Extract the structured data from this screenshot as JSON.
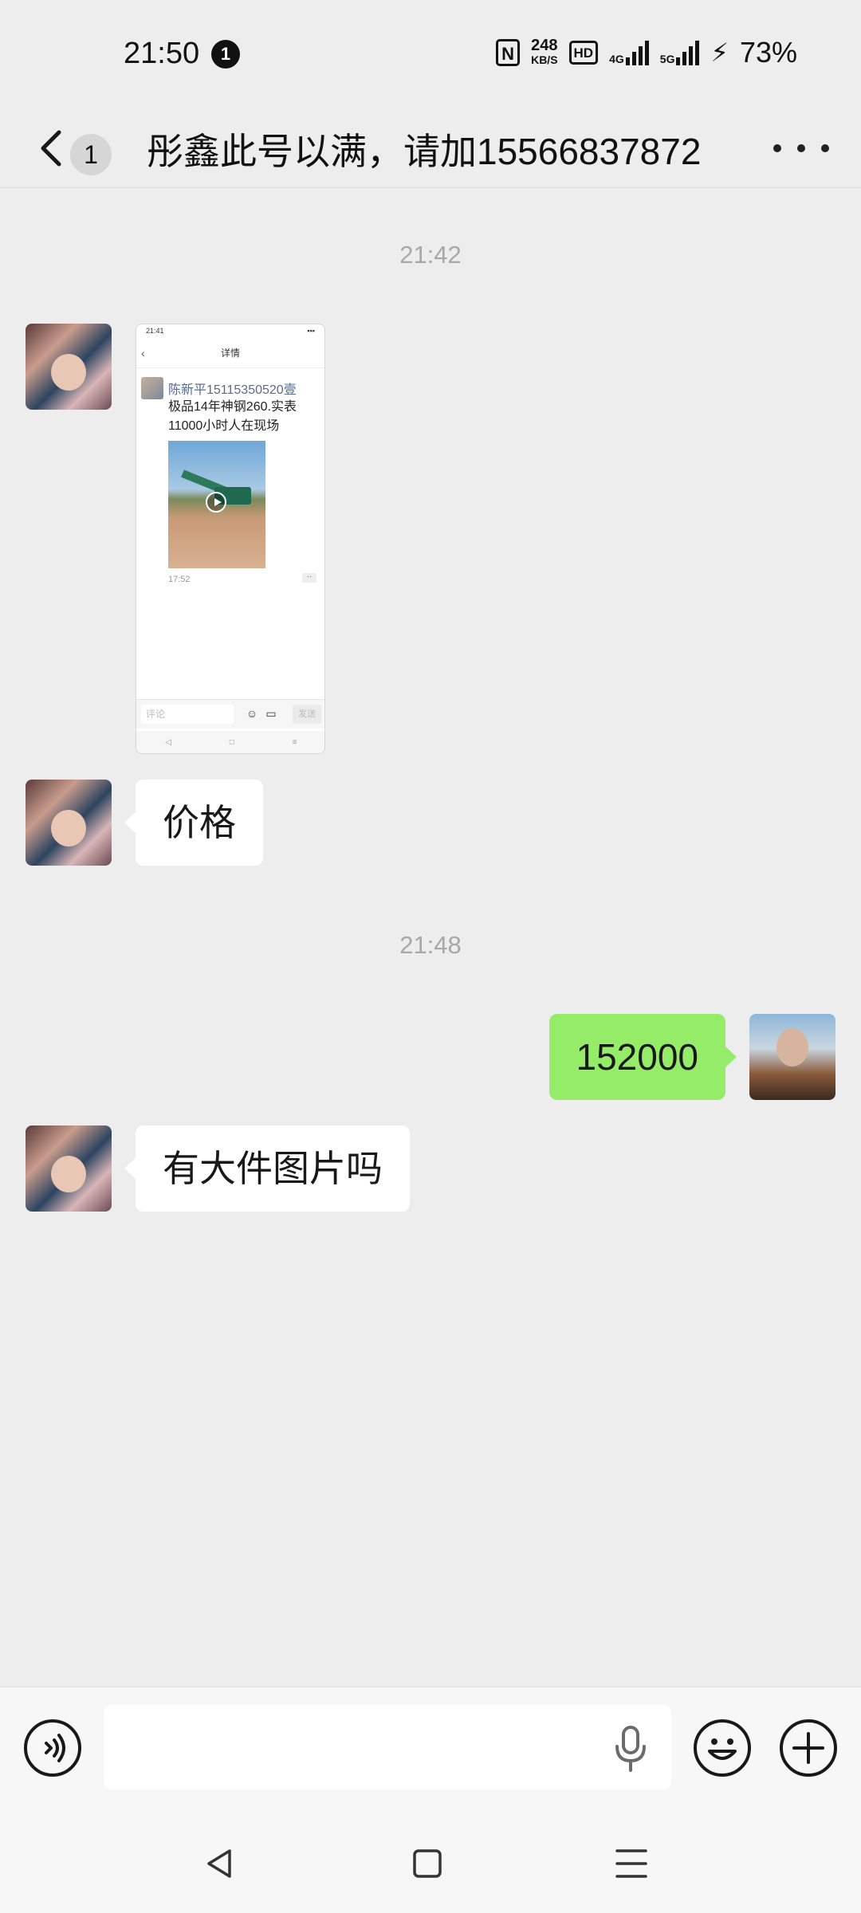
{
  "status_bar": {
    "time": "21:50",
    "notification_count": "1",
    "nfc": "N",
    "net_speed_value": "248",
    "net_speed_unit": "KB/S",
    "hd_label": "HD",
    "network_1": "4G",
    "network_2": "5G",
    "battery": "73%"
  },
  "header": {
    "unread_count": "1",
    "title": "彤鑫此号以满，请加15566837872"
  },
  "messages": {
    "ts1": "21:42",
    "image_msg": {
      "status_time": "21:41",
      "page_title": "详情",
      "poster_name": "陈新平15115350520壹",
      "post_text": "极品14年神钢260.实表11000小时人在现场",
      "post_time": "17:52",
      "comment_placeholder": "评论",
      "send_label": "发送"
    },
    "msg_price": "价格",
    "ts2": "21:48",
    "msg_reply": "152000",
    "msg_big_pic": "有大件图片吗"
  },
  "input_bar": {
    "placeholder": ""
  }
}
